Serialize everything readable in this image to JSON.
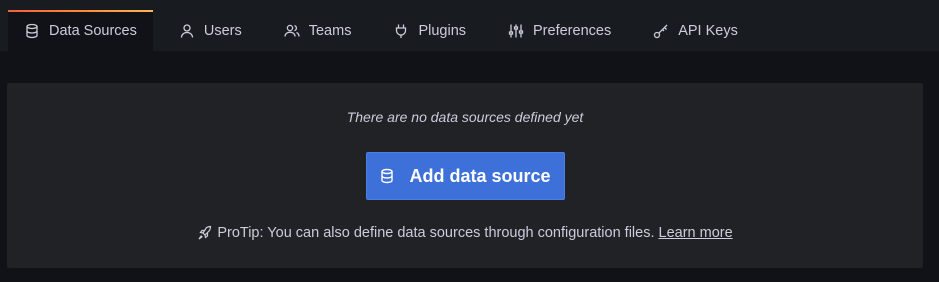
{
  "tabs": [
    {
      "label": "Data Sources",
      "icon": "database-icon",
      "active": true
    },
    {
      "label": "Users",
      "icon": "user-icon",
      "active": false
    },
    {
      "label": "Teams",
      "icon": "users-icon",
      "active": false
    },
    {
      "label": "Plugins",
      "icon": "plug-icon",
      "active": false
    },
    {
      "label": "Preferences",
      "icon": "sliders-icon",
      "active": false
    },
    {
      "label": "API Keys",
      "icon": "key-icon",
      "active": false
    }
  ],
  "empty_state": {
    "title": "There are no data sources defined yet",
    "button_label": "Add data source",
    "button_icon": "database-icon",
    "protip_icon": "rocket-icon",
    "protip_text": "ProTip: You can also define data sources through configuration files.",
    "protip_link": "Learn more"
  },
  "colors": {
    "accent": "#3d71d9",
    "tab_highlight_start": "#f55f3e",
    "tab_highlight_end": "#ffb357"
  }
}
